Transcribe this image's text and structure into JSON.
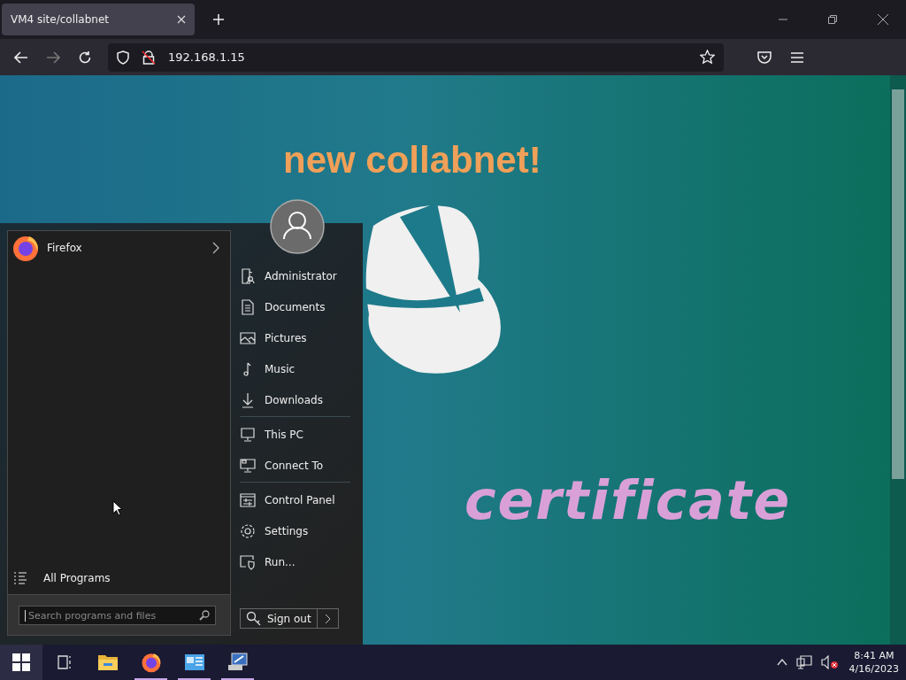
{
  "browser": {
    "tabs": [
      {
        "title": "VM4 site/collabnet",
        "selected": true
      }
    ],
    "nav": {
      "back_disabled": false,
      "forward_disabled": true
    },
    "address": "192.168.1.15"
  },
  "page": {
    "heading": "new collabnet!",
    "subheading": "certificate"
  },
  "start_menu": {
    "pinned": [
      {
        "label": "Firefox",
        "has_submenu": true
      }
    ],
    "all_programs": "All Programs",
    "search": {
      "placeholder": "Search programs and files"
    },
    "place_groups": [
      [
        {
          "kind": "user",
          "label": "Administrator"
        },
        {
          "kind": "documents",
          "label": "Documents"
        },
        {
          "kind": "pictures",
          "label": "Pictures"
        },
        {
          "kind": "music",
          "label": "Music"
        },
        {
          "kind": "downloads",
          "label": "Downloads"
        }
      ],
      [
        {
          "kind": "pc",
          "label": "This PC"
        },
        {
          "kind": "connect",
          "label": "Connect To"
        }
      ],
      [
        {
          "kind": "control",
          "label": "Control Panel"
        },
        {
          "kind": "settings",
          "label": "Settings"
        },
        {
          "kind": "run",
          "label": "Run..."
        }
      ]
    ],
    "sign_out": "Sign out"
  },
  "taskbar": {
    "apps": [
      {
        "kind": "task-view",
        "running": false
      },
      {
        "kind": "explorer",
        "running": false
      },
      {
        "kind": "firefox",
        "running": true
      },
      {
        "kind": "control",
        "running": true
      },
      {
        "kind": "remote",
        "running": true
      }
    ],
    "volume_muted": true,
    "time": "8:41 AM",
    "date": "4/16/2023"
  }
}
